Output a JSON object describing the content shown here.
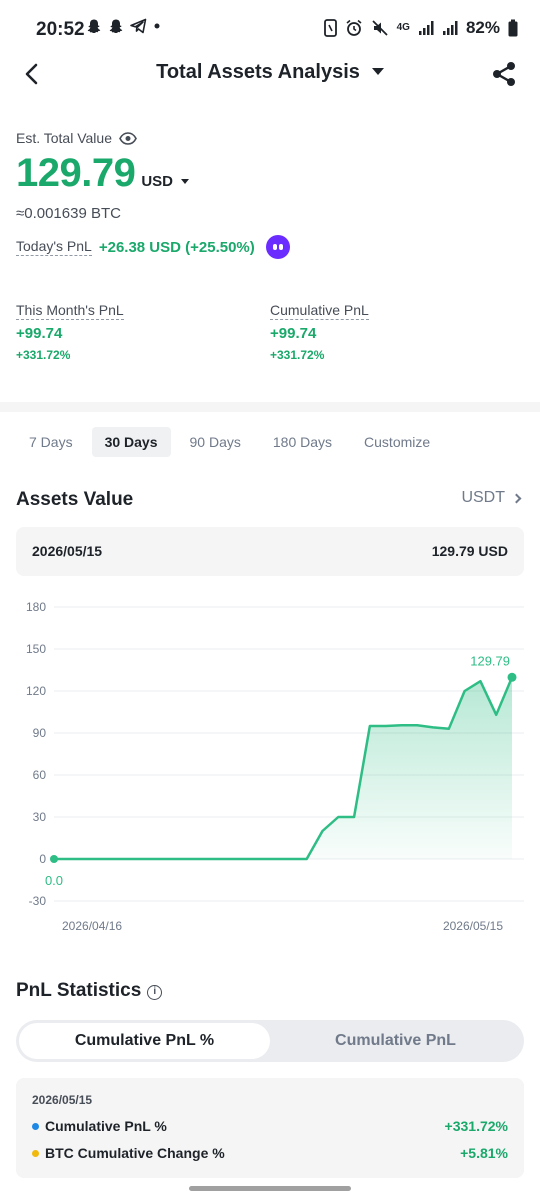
{
  "status_bar": {
    "time": "20:52",
    "battery": "82%",
    "network": "4G"
  },
  "header": {
    "title": "Total Assets Analysis"
  },
  "summary": {
    "est_label": "Est. Total Value",
    "total_value": "129.79",
    "currency": "USD",
    "btc_value": "≈0.001639 BTC",
    "today_pnl_label": "Today's PnL",
    "today_pnl_value": "+26.38 USD (+25.50%)"
  },
  "pnl": {
    "month_label": "This Month's PnL",
    "month_value": "+99.74",
    "month_pct": "+331.72%",
    "cumulative_label": "Cumulative PnL",
    "cumulative_value": "+99.74",
    "cumulative_pct": "+331.72%"
  },
  "range_tabs": [
    "7 Days",
    "30 Days",
    "90 Days",
    "180 Days",
    "Customize"
  ],
  "active_tab": "30 Days",
  "assets": {
    "title": "Assets Value",
    "unit_link": "USDT",
    "card_date": "2026/05/15",
    "card_value": "129.79 USD"
  },
  "chart_data": {
    "type": "area",
    "title": "",
    "xlabel": "",
    "ylabel": "",
    "ylim": [
      -30,
      180
    ],
    "yticks": [
      "180",
      "150",
      "120",
      "90",
      "60",
      "30",
      "0",
      "-30"
    ],
    "x_tick_labels": [
      "2026/04/16",
      "2026/05/15"
    ],
    "x_start": "2026/04/16",
    "x_end": "2026/05/15",
    "start_label": "0.0",
    "end_label": "129.79",
    "grid": true,
    "color": "#2ebd85",
    "series": [
      {
        "values": [
          0,
          0,
          0,
          0,
          0,
          0,
          0,
          0,
          0,
          0,
          0,
          0,
          0,
          0,
          0,
          0,
          0,
          20,
          30,
          30,
          95,
          95,
          95.5,
          95.5,
          94,
          93,
          120,
          127,
          103,
          129.79
        ]
      }
    ]
  },
  "pnl_stats": {
    "title": "PnL Statistics",
    "toggle_options": [
      "Cumulative PnL %",
      "Cumulative PnL"
    ],
    "date": "2026/05/15",
    "rows": [
      {
        "label": "Cumulative PnL %",
        "value": "+331.72%",
        "color": "#1e88e5"
      },
      {
        "label": "BTC Cumulative Change %",
        "value": "+5.81%",
        "color": "#f0b90b"
      }
    ]
  },
  "colors": {
    "accent_green": "#1aa86b",
    "chart_green": "#2ebd85"
  }
}
